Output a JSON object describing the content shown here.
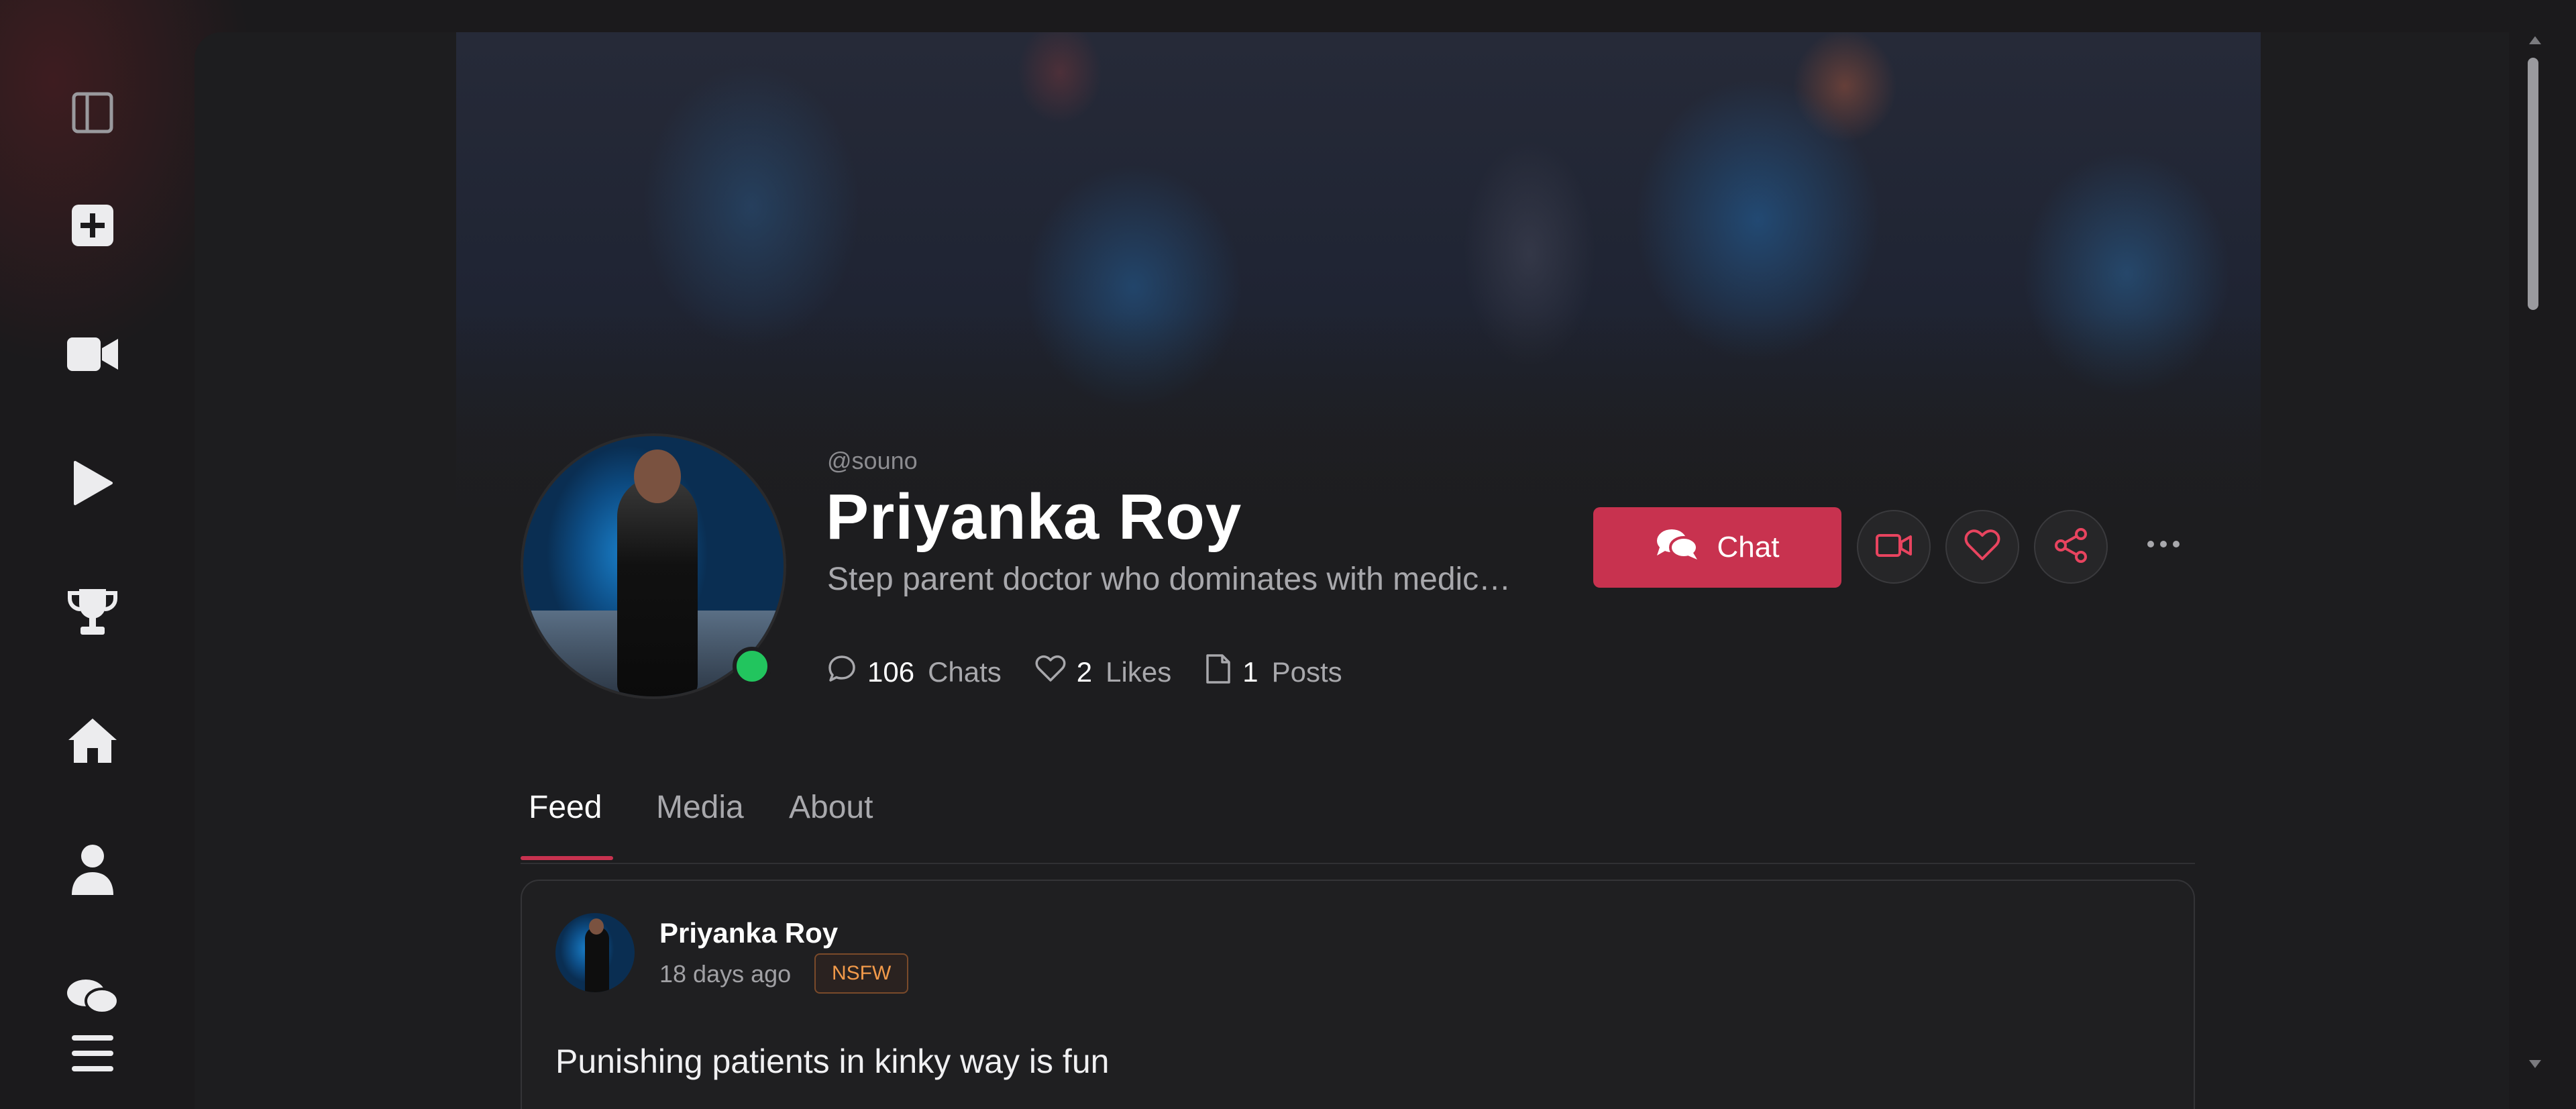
{
  "profile": {
    "handle": "@souno",
    "name": "Priyanka Roy",
    "tagline": "Step parent doctor who dominates with medic…",
    "online": true,
    "stats": [
      {
        "icon": "chat-bubble-icon",
        "value": "106",
        "label": "Chats"
      },
      {
        "icon": "heart-outline-icon",
        "value": "2",
        "label": "Likes"
      },
      {
        "icon": "file-icon",
        "value": "1",
        "label": "Posts"
      }
    ]
  },
  "actions": {
    "chat_label": "Chat"
  },
  "tabs": [
    {
      "label": "Feed",
      "active": true
    },
    {
      "label": "Media",
      "active": false
    },
    {
      "label": "About",
      "active": false
    }
  ],
  "post": {
    "author": "Priyanka Roy",
    "time": "18 days ago",
    "badge": "NSFW",
    "text": "Punishing patients in kinky way is fun"
  },
  "colors": {
    "accent": "#c8324f",
    "online": "#22c55e",
    "badge_text": "#f29a4a"
  }
}
